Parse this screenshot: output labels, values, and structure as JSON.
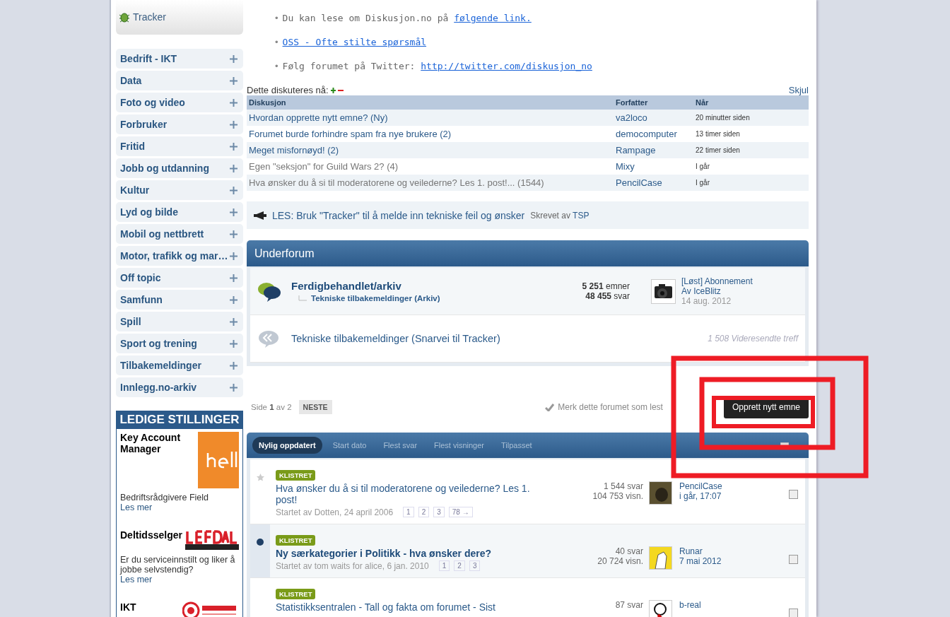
{
  "sidebar": {
    "tracker": "Tracker",
    "categories": [
      {
        "label": "Bedrift - IKT"
      },
      {
        "label": "Data"
      },
      {
        "label": "Foto og video"
      },
      {
        "label": "Forbruker"
      },
      {
        "label": "Fritid"
      },
      {
        "label": "Jobb og utdanning"
      },
      {
        "label": "Kultur"
      },
      {
        "label": "Lyd og bilde"
      },
      {
        "label": "Mobil og nettbrett"
      },
      {
        "label": "Motor, trafikk og mar…"
      },
      {
        "label": "Off topic"
      },
      {
        "label": "Samfunn"
      },
      {
        "label": "Spill"
      },
      {
        "label": "Sport og trening"
      },
      {
        "label": "Tilbakemeldinger"
      },
      {
        "label": "Innlegg.no-arkiv"
      }
    ],
    "jobs": {
      "title": "LEDIGE STILLINGER",
      "items": [
        {
          "title": "Key Account Manager",
          "desc": "Bedriftsrådgivere Field",
          "more": "Les mer"
        },
        {
          "title": "Deltidsselger",
          "desc": "Er du serviceinnstilt og liker å jobbe selvstendig?",
          "more": "Les mer"
        },
        {
          "title": "IKT"
        }
      ]
    }
  },
  "info": [
    {
      "bullet": "•",
      "text": "Du kan lese om Diskusjon.no på ",
      "link": "følgende link."
    },
    {
      "bullet": "•",
      "link": "OSS - Ofte stilte spørsmål"
    },
    {
      "bullet": "•",
      "text": "Følg forumet på Twitter: ",
      "link": "http://twitter.com/diskusjon_no"
    }
  ],
  "now": {
    "title": "Dette diskuteres nå:",
    "hide": "Skjul",
    "columns": [
      "Diskusjon",
      "Forfatter",
      "Når"
    ],
    "rows": [
      {
        "title": "Hvordan opprette nytt emne? (Ny)",
        "author": "va2loco",
        "when": "20 minutter siden",
        "visited": false
      },
      {
        "title": "Forumet burde forhindre spam fra nye brukere (2)",
        "author": "democomputer",
        "when": "13 timer siden",
        "visited": false
      },
      {
        "title": "Meget misfornøyd! (2)",
        "author": "Rampage",
        "when": "22 timer siden",
        "visited": false
      },
      {
        "title": "Egen \"seksjon\" for Guild Wars 2? (4)",
        "author": "Mixy",
        "when": "I går",
        "visited": true
      },
      {
        "title": "Hva ønsker du å si til moderatorene og veilederne? Les 1. post!... (1544)",
        "author": "PencilCase",
        "when": "I går",
        "visited": true
      }
    ]
  },
  "notice": {
    "title": "LES: Bruk \"Tracker\" til å melde inn tekniske feil og ønsker",
    "by": "Skrevet av",
    "author": "TSP"
  },
  "subforum": {
    "title": "Underforum",
    "items": [
      {
        "kind": "forum",
        "name": "Ferdigbehandlet/arkiv",
        "sub": "Tekniske tilbakemeldinger (Arkiv)",
        "topics": "5 251",
        "topics_label": "emner",
        "posts": "48 455",
        "posts_label": "svar",
        "last_title": "[Løst] Abonnement",
        "last_by": "Av",
        "last_author": "IceBlitz",
        "last_date": "14 aug. 2012"
      },
      {
        "kind": "redirect",
        "name": "Tekniske tilbakemeldinger (Snarvei til Tracker)",
        "hits": "1 508 Videresendte treff"
      }
    ]
  },
  "pager": {
    "side": "Side",
    "page": "1",
    "of": "av 2",
    "next": "NESTE",
    "mark_read": "Merk dette forumet som lest",
    "new_topic": "Opprett nytt emne"
  },
  "sort_tabs": [
    {
      "label": "Nylig oppdatert",
      "selected": true
    },
    {
      "label": "Start dato",
      "selected": false
    },
    {
      "label": "Flest svar",
      "selected": false
    },
    {
      "label": "Flest visninger",
      "selected": false
    },
    {
      "label": "Tilpasset",
      "selected": false
    }
  ],
  "topics": [
    {
      "kind": "star",
      "unread": false,
      "tag": "KLISTRET",
      "title": "Hva ønsker du å si til moderatorene og veilederne? Les 1. post!",
      "started": "Startet av Dotten, 24 april 2006",
      "pages": [
        "1",
        "2",
        "3",
        "78 →"
      ],
      "replies": "1 544 svar",
      "views": "104 753 visn.",
      "last_author": "PencilCase",
      "last_date": "i går, 17:07",
      "checked": false
    },
    {
      "kind": "dot",
      "unread": true,
      "tag": "KLISTRET",
      "title": "Ny særkategorier i Politikk - hva ønsker dere?",
      "started": "Startet av tom waits for alice, 6 jan. 2010",
      "pages": [
        "1",
        "2",
        "3"
      ],
      "replies": "40 svar",
      "views": "20 724 visn.",
      "last_author": "Runar",
      "last_date": "7 mai 2012",
      "checked": false
    },
    {
      "kind": "plain",
      "unread": false,
      "tag": "KLISTRET",
      "title": "Statistikksentralen - Tall og fakta om forumet - Sist",
      "replies": "87 svar",
      "last_author": "b-real",
      "checked": false
    }
  ]
}
